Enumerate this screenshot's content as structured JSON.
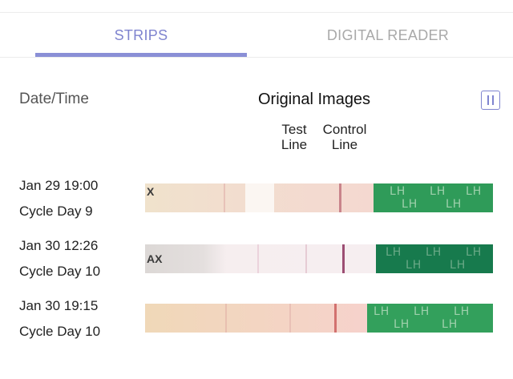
{
  "tabs": {
    "strips": "STRIPS",
    "reader": "DIGITAL READER",
    "active": "strips"
  },
  "header": {
    "date_label": "Date/Time",
    "images_label": "Original Images"
  },
  "columns": {
    "test": "Test\nLine",
    "control": "Control\nLine"
  },
  "colors": {
    "accent": "#8a8fd6",
    "strip_green": "#2e9a58"
  },
  "rows": [
    {
      "date": "Jan 29 19:00",
      "cycle": "Cycle Day 9",
      "strip_mark": "X"
    },
    {
      "date": "Jan 30 12:26",
      "cycle": "Cycle Day 10",
      "strip_mark": "AX"
    },
    {
      "date": "Jan 30 19:15",
      "cycle": "Cycle Day 10",
      "strip_mark": ""
    }
  ],
  "strip_text": "LH"
}
